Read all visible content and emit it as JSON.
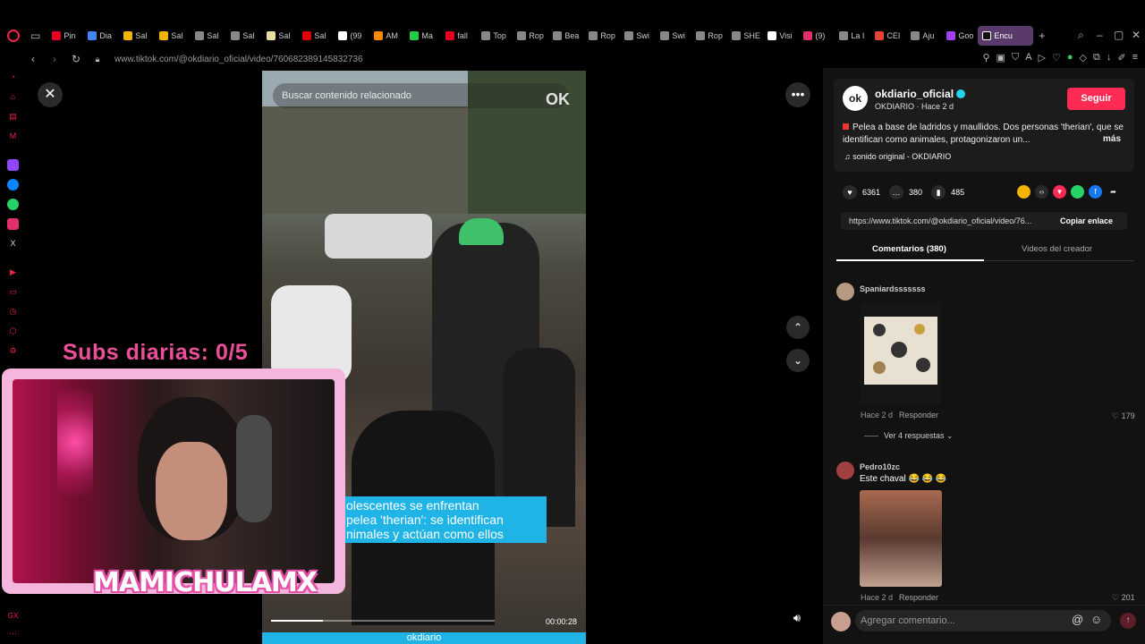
{
  "browser": {
    "tabs": [
      {
        "label": "Pin",
        "color": "#e60023"
      },
      {
        "label": "Dia",
        "color": "#4285f4"
      },
      {
        "label": "Sal",
        "color": "#f5b400"
      },
      {
        "label": "Sal",
        "color": "#f5b400"
      },
      {
        "label": "Sal",
        "color": "#888888"
      },
      {
        "label": "Sal",
        "color": "#888888"
      },
      {
        "label": "Sal",
        "color": "#e8e0a0"
      },
      {
        "label": "Sal",
        "color": "#e00000"
      },
      {
        "label": "(99",
        "color": "#ffffff"
      },
      {
        "label": "AM",
        "color": "#ff8a00"
      },
      {
        "label": "Ma",
        "color": "#22cc44"
      },
      {
        "label": "fall",
        "color": "#e60023"
      },
      {
        "label": "Top",
        "color": "#888888"
      },
      {
        "label": "Rop",
        "color": "#888888"
      },
      {
        "label": "Bea",
        "color": "#888888"
      },
      {
        "label": "Rop",
        "color": "#888888"
      },
      {
        "label": "Swi",
        "color": "#888888"
      },
      {
        "label": "Swi",
        "color": "#888888"
      },
      {
        "label": "Rop",
        "color": "#888888"
      },
      {
        "label": "SHE",
        "color": "#888888"
      },
      {
        "label": "Visi",
        "color": "#ffffff"
      },
      {
        "label": "(9)",
        "color": "#e1306c"
      },
      {
        "label": "La I",
        "color": "#888888"
      },
      {
        "label": "CEI",
        "color": "#ea4335"
      },
      {
        "label": "Aju",
        "color": "#888888"
      },
      {
        "label": "Goo",
        "color": "#a142f4"
      }
    ],
    "active_tab": {
      "label": "Encu",
      "color": "#ffffff"
    },
    "new_tab": "+",
    "url": "www.tiktok.com/@okdiario_oficial/video/7606823891458327​36"
  },
  "video": {
    "search_placeholder": "Buscar contenido relacionado",
    "watermark": "OK",
    "caption_lines": [
      "olescentes se enfrentan",
      "pelea 'therian': se identifican",
      "nimales y actúan como ellos"
    ],
    "time": "00:00:28",
    "progress": 0.23,
    "brand": "okdiario"
  },
  "overlay": {
    "subs": "Subs diarias: 0/5",
    "streamer": "MAMICHULAMX"
  },
  "panel": {
    "author_name": "okdiario_oficial",
    "author_avatar": "ok",
    "author_sub": "OKDIARIO · Hace 2 d",
    "follow": "Seguir",
    "description": "Pelea a base de ladridos y maullidos. Dos personas 'therian', que se identifican como animales, protagonizaron un...",
    "more": "más",
    "sound": "sonido original - OKDIARIO",
    "likes": "6361",
    "comments": "380",
    "saves": "485",
    "link": "https://www.tiktok.com/@okdiario_oficial/video/76...",
    "copy": "Copiar enlace",
    "tab_comments": "Comentarios (380)",
    "tab_creator": "Videos del creador",
    "comment1": {
      "user": "Spaniardsssssss",
      "time": "Hace 2 d",
      "reply": "Responder",
      "likes": "179",
      "view_replies": "Ver 4 respuestas"
    },
    "comment2": {
      "user": "Pedro10zc",
      "text": "Este chaval 😂 😂 😂",
      "time": "Hace 2 d",
      "reply": "Responder",
      "likes": "201"
    },
    "composer_placeholder": "Agregar comentario..."
  }
}
